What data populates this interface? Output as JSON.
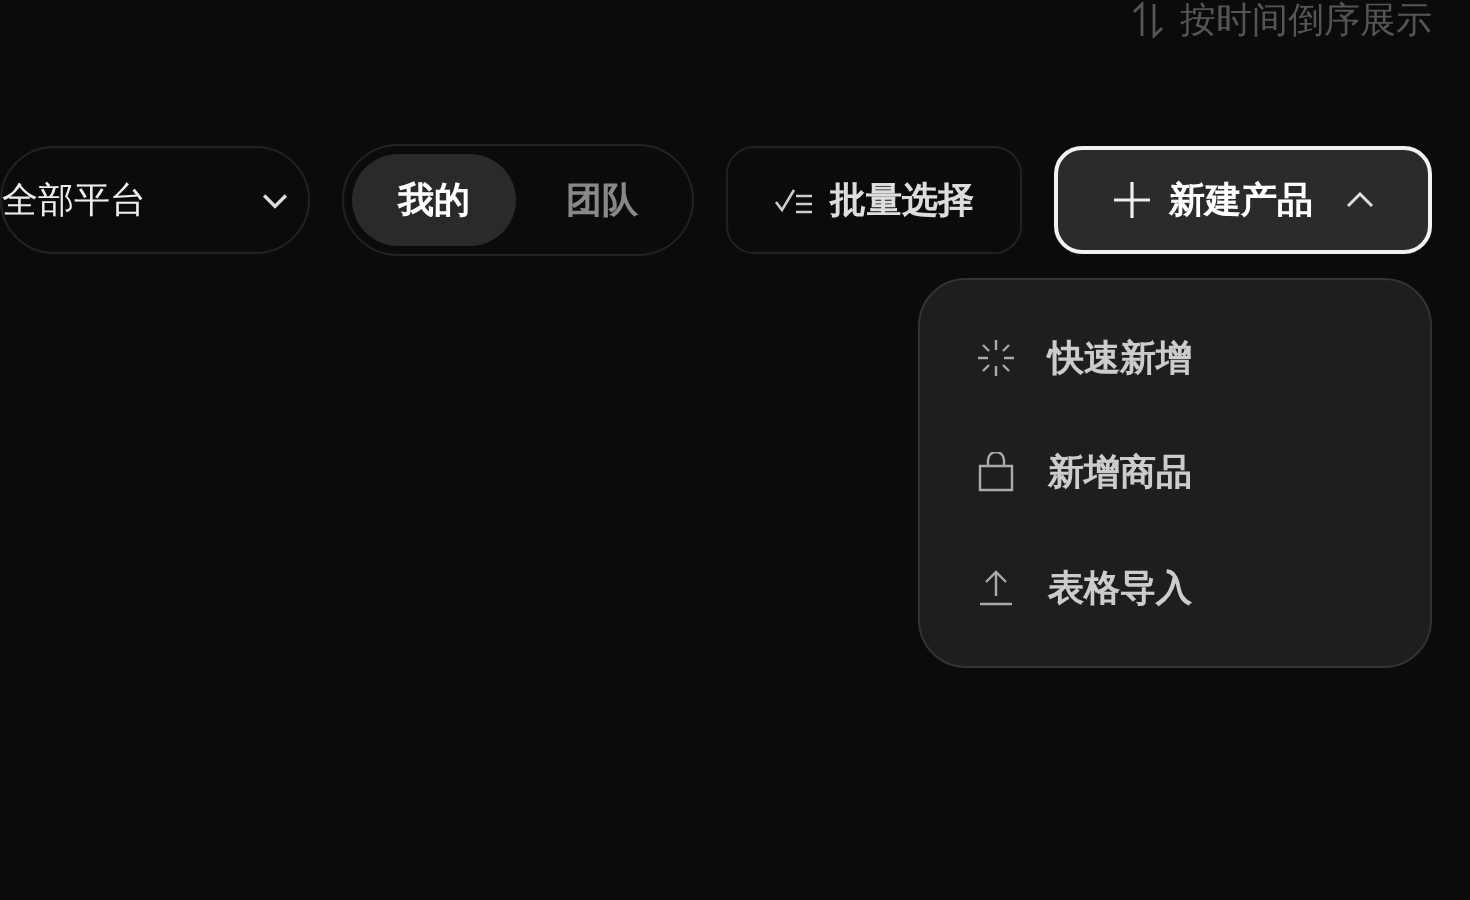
{
  "sort": {
    "label": "按时间倒序展示"
  },
  "platform_select": {
    "value": "全部平台"
  },
  "tabs": [
    {
      "label": "我的",
      "selected": true
    },
    {
      "label": "团队",
      "selected": false
    }
  ],
  "batch_button": {
    "label": "批量选择"
  },
  "new_button": {
    "label": "新建产品",
    "expanded": true
  },
  "menu": [
    {
      "label": "快速新增",
      "kind": "sparkle"
    },
    {
      "label": "新增商品",
      "kind": "bag"
    },
    {
      "label": "表格导入",
      "kind": "upload"
    }
  ]
}
